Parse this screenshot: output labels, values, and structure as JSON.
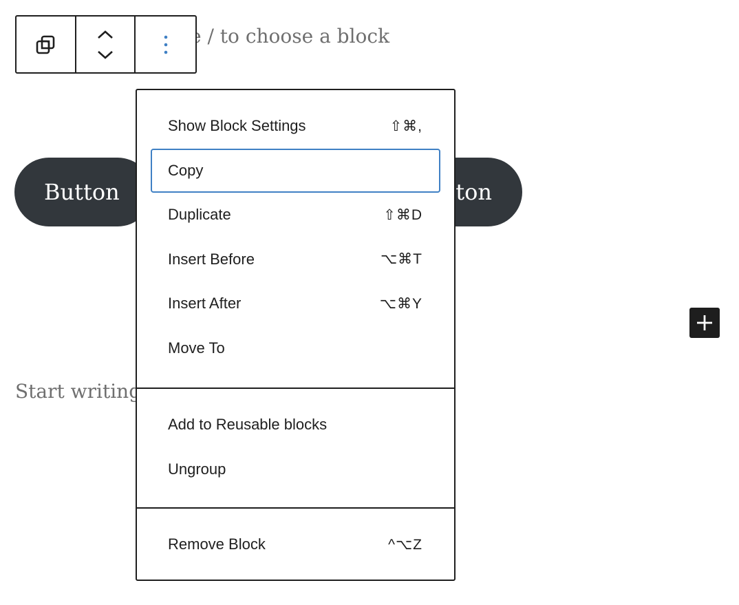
{
  "editor": {
    "hint_text": "e / to choose a block",
    "start_writing": "Start writing",
    "button_left_label": "Button",
    "button_right_label": "tton"
  },
  "toolbar": {
    "icons": [
      "block-type-icon",
      "move-up-down-icon",
      "more-options-icon"
    ]
  },
  "menu": {
    "group1": [
      {
        "label": "Show Block Settings",
        "shortcut": "⇧⌘,"
      },
      {
        "label": "Copy",
        "shortcut": ""
      },
      {
        "label": "Duplicate",
        "shortcut": "⇧⌘D"
      },
      {
        "label": "Insert Before",
        "shortcut": "⌥⌘T"
      },
      {
        "label": "Insert After",
        "shortcut": "⌥⌘Y"
      },
      {
        "label": "Move To",
        "shortcut": ""
      }
    ],
    "group2": [
      {
        "label": "Add to Reusable blocks"
      },
      {
        "label": "Ungroup"
      }
    ],
    "group3": [
      {
        "label": "Remove Block",
        "shortcut": "^⌥Z"
      }
    ]
  },
  "colors": {
    "accent": "#3f80c4",
    "button_bg": "#32373c",
    "text": "#1e1e1e",
    "placeholder": "#6f6f6f"
  }
}
